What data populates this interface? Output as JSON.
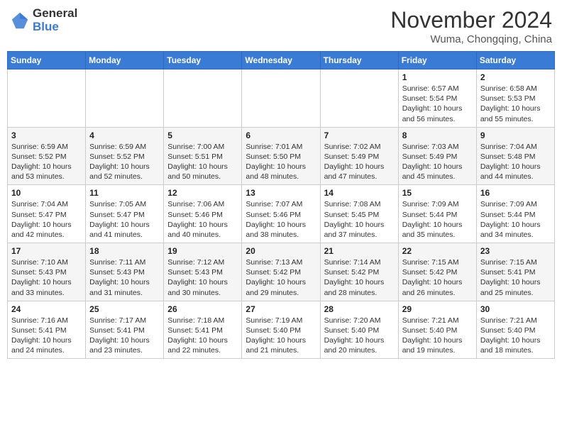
{
  "header": {
    "logo_general": "General",
    "logo_blue": "Blue",
    "title": "November 2024",
    "location": "Wuma, Chongqing, China"
  },
  "weekdays": [
    "Sunday",
    "Monday",
    "Tuesday",
    "Wednesday",
    "Thursday",
    "Friday",
    "Saturday"
  ],
  "weeks": [
    [
      {
        "day": "",
        "info": ""
      },
      {
        "day": "",
        "info": ""
      },
      {
        "day": "",
        "info": ""
      },
      {
        "day": "",
        "info": ""
      },
      {
        "day": "",
        "info": ""
      },
      {
        "day": "1",
        "info": "Sunrise: 6:57 AM\nSunset: 5:54 PM\nDaylight: 10 hours and 56 minutes."
      },
      {
        "day": "2",
        "info": "Sunrise: 6:58 AM\nSunset: 5:53 PM\nDaylight: 10 hours and 55 minutes."
      }
    ],
    [
      {
        "day": "3",
        "info": "Sunrise: 6:59 AM\nSunset: 5:52 PM\nDaylight: 10 hours and 53 minutes."
      },
      {
        "day": "4",
        "info": "Sunrise: 6:59 AM\nSunset: 5:52 PM\nDaylight: 10 hours and 52 minutes."
      },
      {
        "day": "5",
        "info": "Sunrise: 7:00 AM\nSunset: 5:51 PM\nDaylight: 10 hours and 50 minutes."
      },
      {
        "day": "6",
        "info": "Sunrise: 7:01 AM\nSunset: 5:50 PM\nDaylight: 10 hours and 48 minutes."
      },
      {
        "day": "7",
        "info": "Sunrise: 7:02 AM\nSunset: 5:49 PM\nDaylight: 10 hours and 47 minutes."
      },
      {
        "day": "8",
        "info": "Sunrise: 7:03 AM\nSunset: 5:49 PM\nDaylight: 10 hours and 45 minutes."
      },
      {
        "day": "9",
        "info": "Sunrise: 7:04 AM\nSunset: 5:48 PM\nDaylight: 10 hours and 44 minutes."
      }
    ],
    [
      {
        "day": "10",
        "info": "Sunrise: 7:04 AM\nSunset: 5:47 PM\nDaylight: 10 hours and 42 minutes."
      },
      {
        "day": "11",
        "info": "Sunrise: 7:05 AM\nSunset: 5:47 PM\nDaylight: 10 hours and 41 minutes."
      },
      {
        "day": "12",
        "info": "Sunrise: 7:06 AM\nSunset: 5:46 PM\nDaylight: 10 hours and 40 minutes."
      },
      {
        "day": "13",
        "info": "Sunrise: 7:07 AM\nSunset: 5:46 PM\nDaylight: 10 hours and 38 minutes."
      },
      {
        "day": "14",
        "info": "Sunrise: 7:08 AM\nSunset: 5:45 PM\nDaylight: 10 hours and 37 minutes."
      },
      {
        "day": "15",
        "info": "Sunrise: 7:09 AM\nSunset: 5:44 PM\nDaylight: 10 hours and 35 minutes."
      },
      {
        "day": "16",
        "info": "Sunrise: 7:09 AM\nSunset: 5:44 PM\nDaylight: 10 hours and 34 minutes."
      }
    ],
    [
      {
        "day": "17",
        "info": "Sunrise: 7:10 AM\nSunset: 5:43 PM\nDaylight: 10 hours and 33 minutes."
      },
      {
        "day": "18",
        "info": "Sunrise: 7:11 AM\nSunset: 5:43 PM\nDaylight: 10 hours and 31 minutes."
      },
      {
        "day": "19",
        "info": "Sunrise: 7:12 AM\nSunset: 5:43 PM\nDaylight: 10 hours and 30 minutes."
      },
      {
        "day": "20",
        "info": "Sunrise: 7:13 AM\nSunset: 5:42 PM\nDaylight: 10 hours and 29 minutes."
      },
      {
        "day": "21",
        "info": "Sunrise: 7:14 AM\nSunset: 5:42 PM\nDaylight: 10 hours and 28 minutes."
      },
      {
        "day": "22",
        "info": "Sunrise: 7:15 AM\nSunset: 5:42 PM\nDaylight: 10 hours and 26 minutes."
      },
      {
        "day": "23",
        "info": "Sunrise: 7:15 AM\nSunset: 5:41 PM\nDaylight: 10 hours and 25 minutes."
      }
    ],
    [
      {
        "day": "24",
        "info": "Sunrise: 7:16 AM\nSunset: 5:41 PM\nDaylight: 10 hours and 24 minutes."
      },
      {
        "day": "25",
        "info": "Sunrise: 7:17 AM\nSunset: 5:41 PM\nDaylight: 10 hours and 23 minutes."
      },
      {
        "day": "26",
        "info": "Sunrise: 7:18 AM\nSunset: 5:41 PM\nDaylight: 10 hours and 22 minutes."
      },
      {
        "day": "27",
        "info": "Sunrise: 7:19 AM\nSunset: 5:40 PM\nDaylight: 10 hours and 21 minutes."
      },
      {
        "day": "28",
        "info": "Sunrise: 7:20 AM\nSunset: 5:40 PM\nDaylight: 10 hours and 20 minutes."
      },
      {
        "day": "29",
        "info": "Sunrise: 7:21 AM\nSunset: 5:40 PM\nDaylight: 10 hours and 19 minutes."
      },
      {
        "day": "30",
        "info": "Sunrise: 7:21 AM\nSunset: 5:40 PM\nDaylight: 10 hours and 18 minutes."
      }
    ]
  ]
}
